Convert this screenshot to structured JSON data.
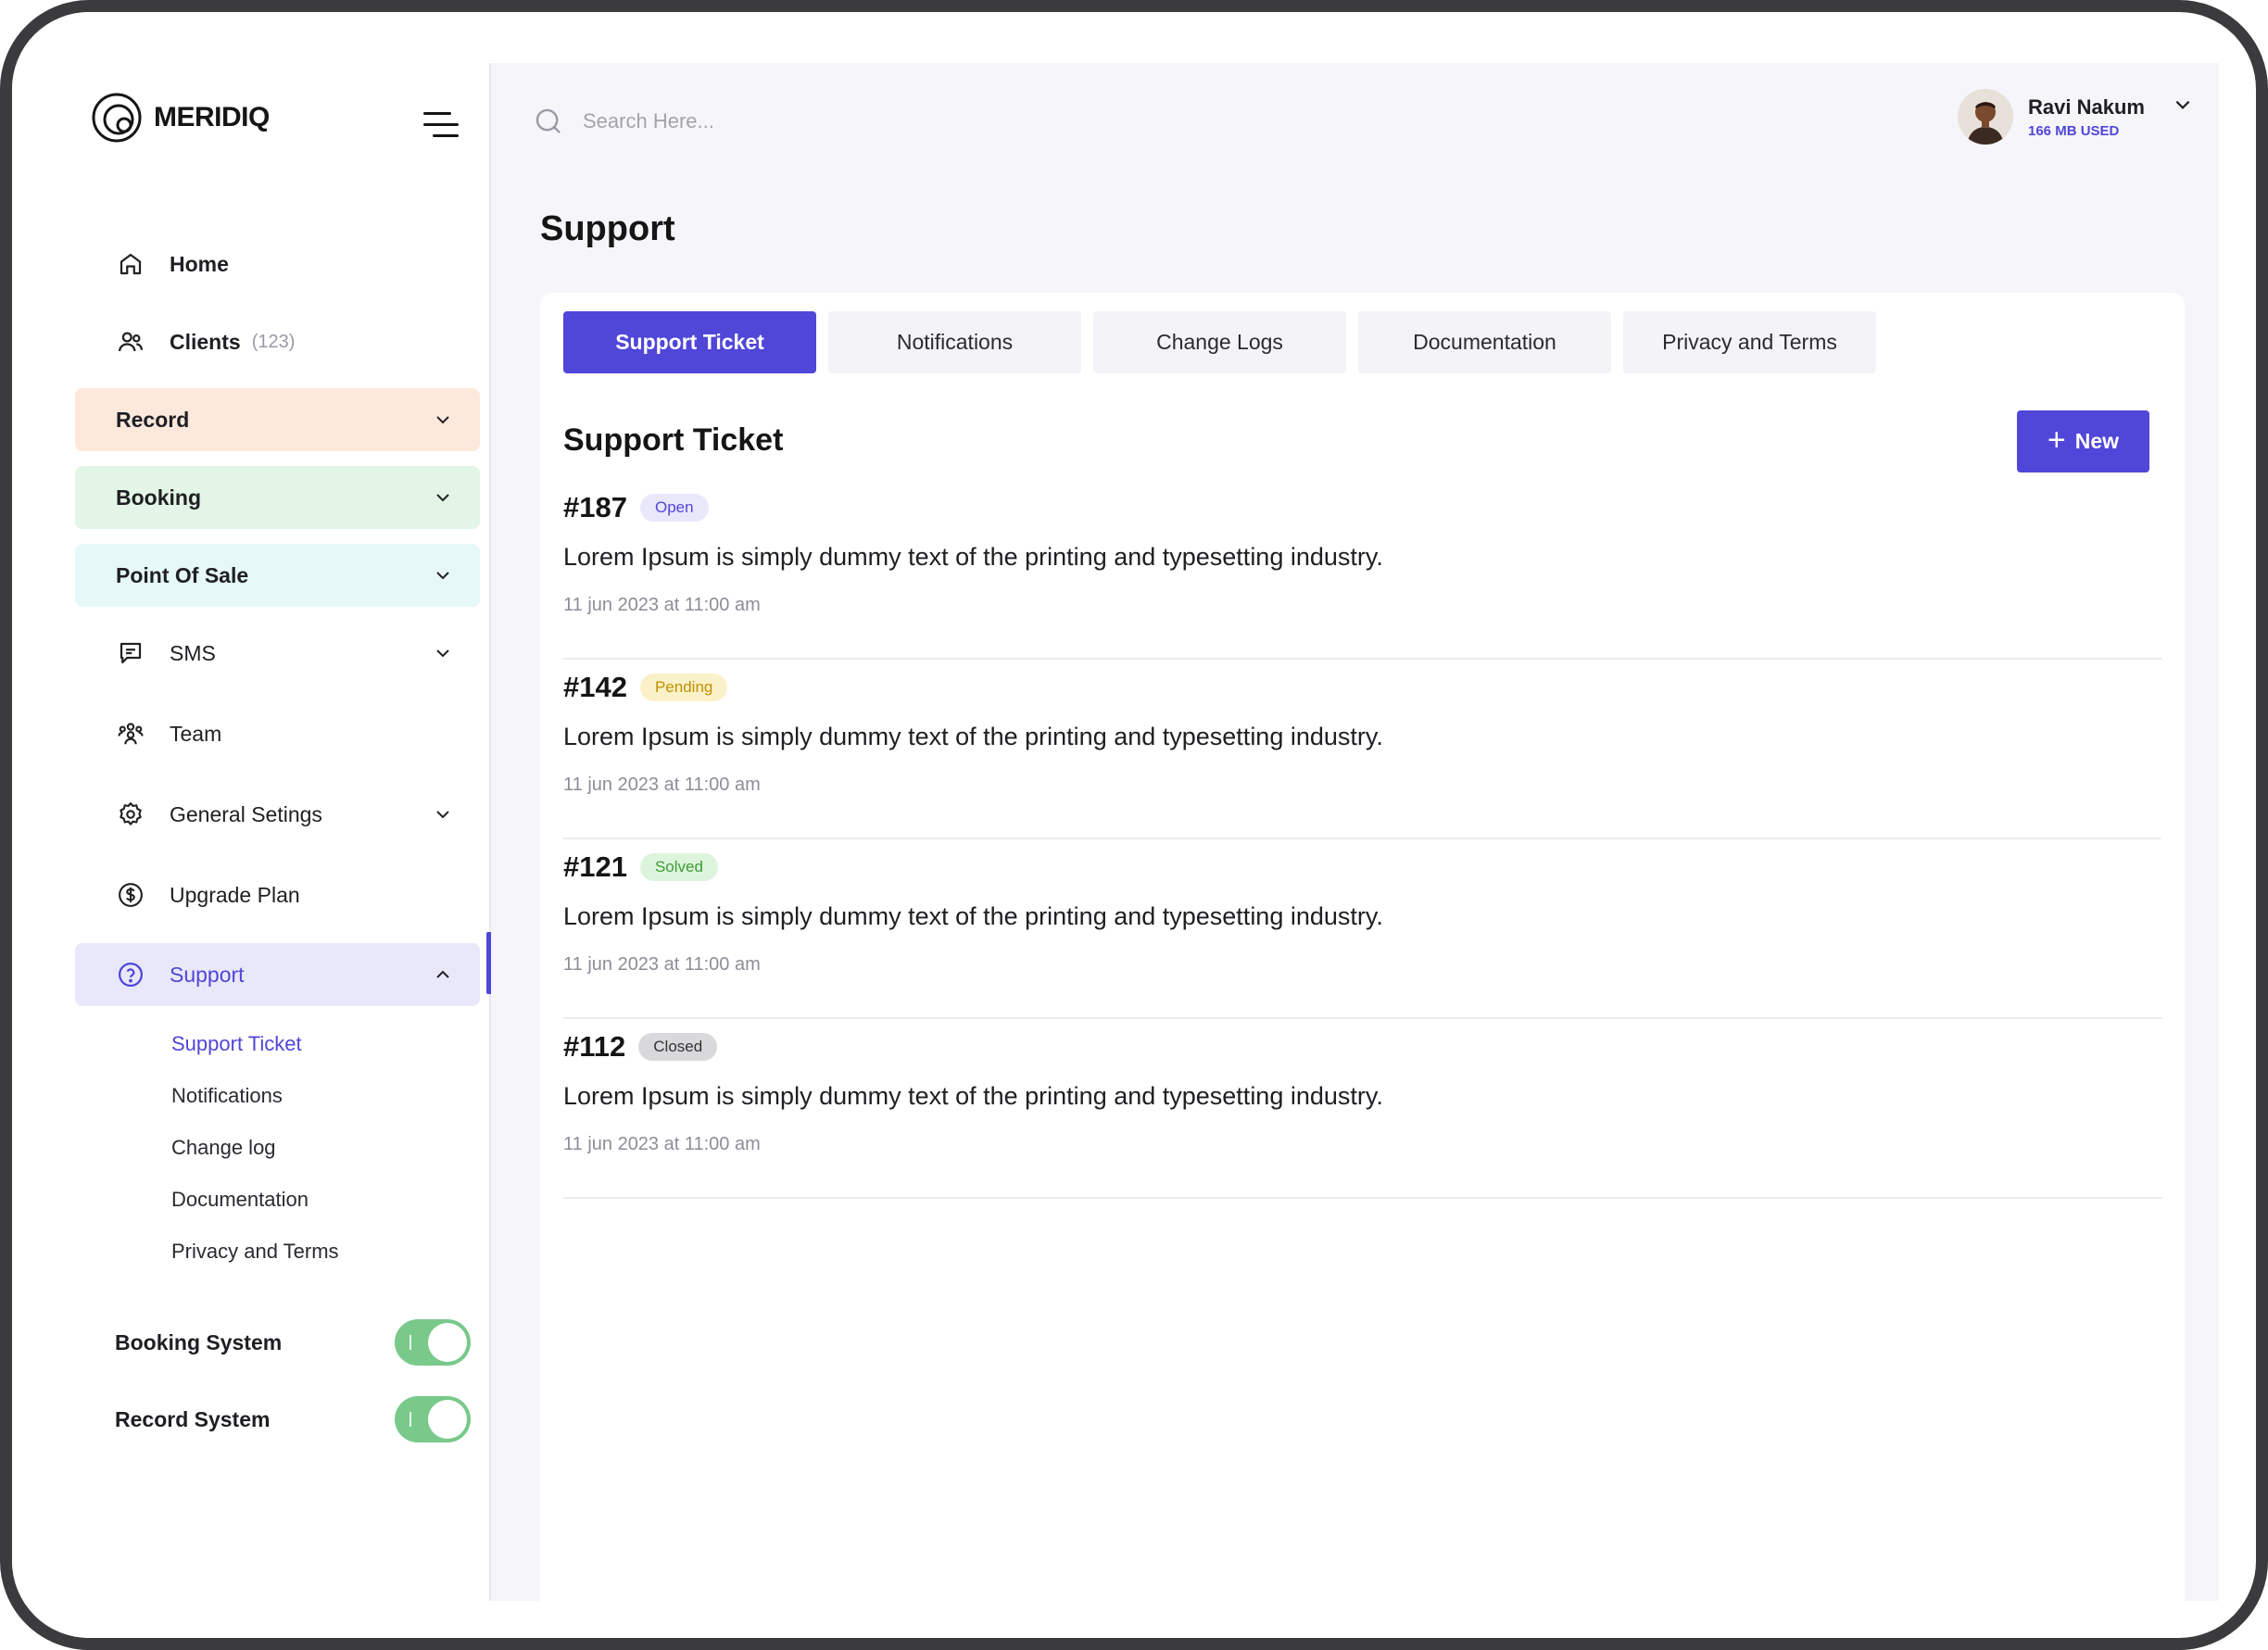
{
  "app": {
    "brand": "MERIDIQ"
  },
  "sidebar": {
    "items": [
      {
        "label": "Home",
        "icon": "home-icon"
      },
      {
        "label": "Clients",
        "count": "(123)",
        "icon": "users-icon"
      },
      {
        "label": "Record",
        "bg": "#fde8dc"
      },
      {
        "label": "Booking",
        "bg": "#e2f5e6"
      },
      {
        "label": "Point Of Sale",
        "bg": "#e6f9f8"
      },
      {
        "label": "SMS",
        "icon": "message-icon"
      },
      {
        "label": "Team",
        "icon": "team-icon"
      },
      {
        "label": "General Setings",
        "icon": "gear-icon"
      },
      {
        "label": "Upgrade Plan",
        "icon": "dollar-icon"
      },
      {
        "label": "Support",
        "icon": "help-icon",
        "bg": "#e9e8fb"
      }
    ],
    "support_sub": [
      {
        "label": "Support Ticket"
      },
      {
        "label": "Notifications"
      },
      {
        "label": "Change log"
      },
      {
        "label": "Documentation"
      },
      {
        "label": "Privacy and Terms"
      }
    ],
    "toggles": [
      {
        "label": "Booking System",
        "on": true
      },
      {
        "label": "Record System",
        "on": true
      }
    ]
  },
  "header": {
    "search_placeholder": "Search Here...",
    "user_name": "Ravi Nakum",
    "storage": "166 MB USED"
  },
  "page": {
    "title": "Support",
    "tabs": [
      {
        "label": "Support Ticket",
        "active": true
      },
      {
        "label": "Notifications"
      },
      {
        "label": "Change Logs"
      },
      {
        "label": "Documentation"
      },
      {
        "label": "Privacy and Terms"
      }
    ],
    "section_title": "Support Ticket",
    "new_label": "New",
    "tickets": [
      {
        "id": "#187",
        "status": "Open",
        "desc": "Lorem Ipsum is simply dummy text of the printing and typesetting industry.",
        "date": "11 jun 2023 at 11:00 am"
      },
      {
        "id": "#142",
        "status": "Pending",
        "desc": "Lorem Ipsum is simply dummy text of the printing and typesetting industry.",
        "date": "11 jun 2023 at 11:00 am"
      },
      {
        "id": "#121",
        "status": "Solved",
        "desc": "Lorem Ipsum is simply dummy text of the printing and typesetting industry.",
        "date": "11 jun 2023 at 11:00 am"
      },
      {
        "id": "#112",
        "status": "Closed",
        "desc": "Lorem Ipsum is simply dummy text of the printing and typesetting industry.",
        "date": "11 jun 2023 at 11:00 am"
      }
    ]
  },
  "colors": {
    "accent": "#5046d8",
    "toggle_on": "#78c98a"
  }
}
